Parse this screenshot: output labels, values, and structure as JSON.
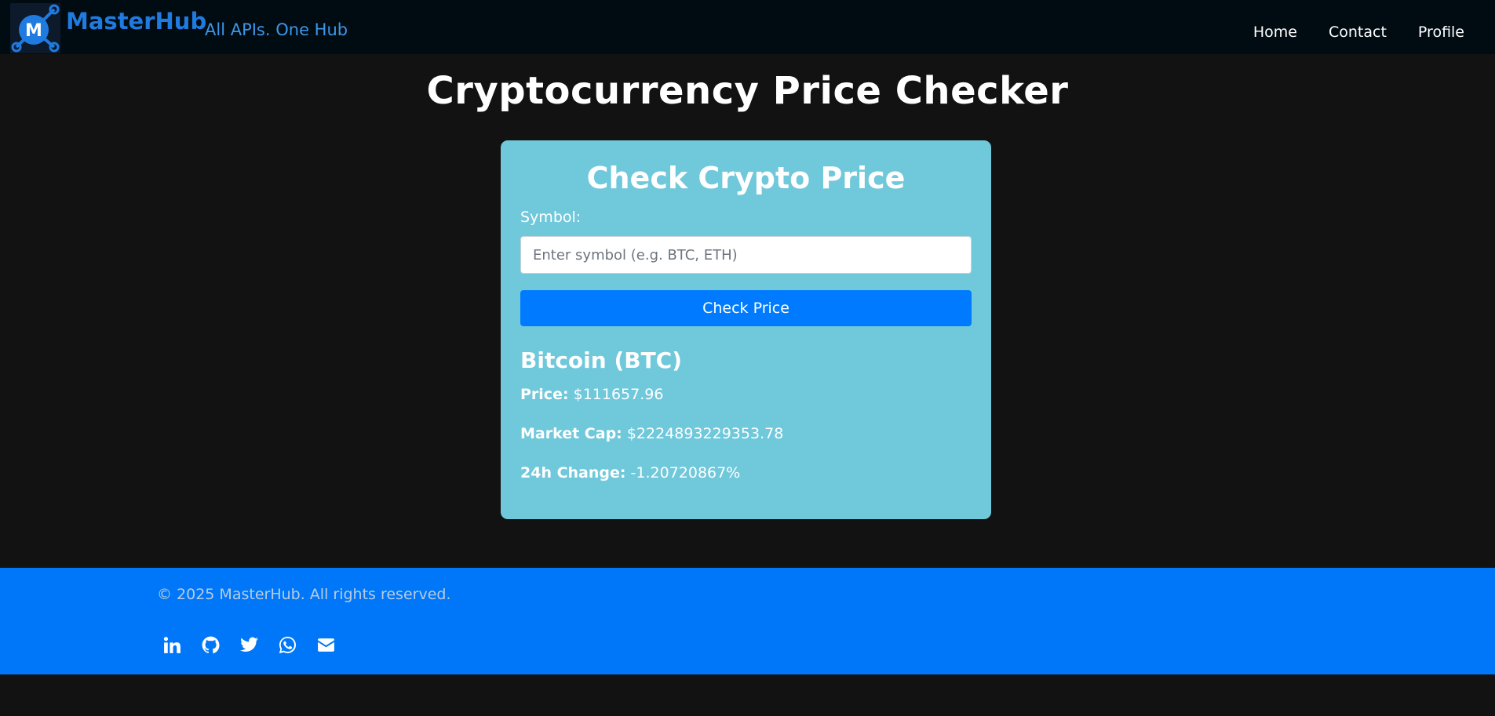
{
  "navbar": {
    "logo_letter": "M",
    "brand_name": "MasterHub",
    "tagline": "All APIs. One Hub",
    "links": [
      {
        "label": "Home"
      },
      {
        "label": "Contact"
      },
      {
        "label": "Profile"
      }
    ]
  },
  "page": {
    "title": "Cryptocurrency Price Checker"
  },
  "card": {
    "title": "Check Crypto Price",
    "symbol_label": "Symbol:",
    "symbol_input": {
      "value": "",
      "placeholder": "Enter symbol (e.g. BTC, ETH)"
    },
    "button_label": "Check Price",
    "result": {
      "name": "Bitcoin (BTC)",
      "price_label": "Price:",
      "price_value": "$111657.96",
      "market_cap_label": "Market Cap:",
      "market_cap_value": "$2224893229353.78",
      "change_label": "24h Change:",
      "change_value": "-1.20720867%"
    }
  },
  "footer": {
    "copyright": "© 2025 MasterHub. All rights reserved.",
    "socials": [
      {
        "icon": "linkedin-icon"
      },
      {
        "icon": "github-icon"
      },
      {
        "icon": "twitter-icon"
      },
      {
        "icon": "whatsapp-icon"
      },
      {
        "icon": "email-icon"
      }
    ]
  },
  "colors": {
    "background": "#121212",
    "navbar": "#000b12",
    "brand": "#1f7be0",
    "card": "#70c8db",
    "button": "#007bff",
    "footer": "#0077f8"
  }
}
